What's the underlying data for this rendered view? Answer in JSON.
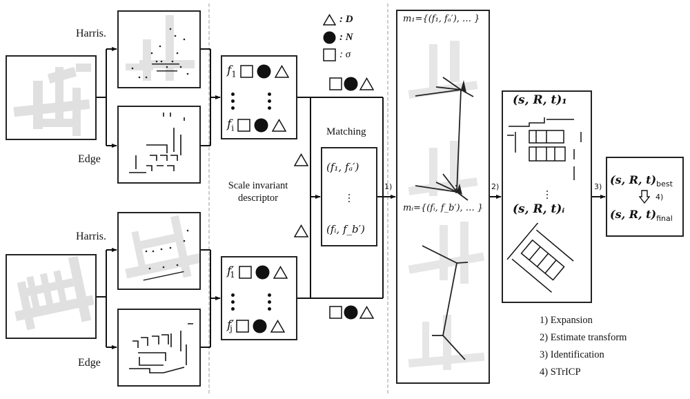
{
  "figure": {
    "branch_labels": {
      "top_harris": "Harris.",
      "top_edge": "Edge",
      "bottom_harris": "Harris.",
      "bottom_edge": "Edge"
    },
    "legend": {
      "items": [
        {
          "symbol": "triangle",
          "label": ": D"
        },
        {
          "symbol": "filled-circle",
          "label": ": N"
        },
        {
          "symbol": "square",
          "label": ": σ"
        }
      ]
    },
    "descriptor": {
      "caption_line1": "Scale invariant",
      "caption_line2": "descriptor",
      "top_rows": [
        {
          "feature": "f",
          "sub": "1",
          "prime": ""
        },
        {
          "feature": "f",
          "sub": "i",
          "prime": ""
        }
      ],
      "bottom_rows": [
        {
          "feature": "f",
          "sub": "1",
          "prime": "′"
        },
        {
          "feature": "f",
          "sub": "j",
          "prime": "′"
        }
      ]
    },
    "matching": {
      "title": "Matching",
      "pair_first": "(f₁, fₐ′)",
      "pair_last": "(fᵢ, f_b′)",
      "ellipsis": "⋮"
    },
    "expansion": {
      "m1_label": "m₁={(f₁, fₐ′), … }",
      "mi_label": "mᵢ={(fᵢ, f_b′), … }"
    },
    "transforms": {
      "first_label": "(s, R, t)₁",
      "ith_label": "(s, R, t)ᵢ"
    },
    "final": {
      "best_label": "(s, R, t)",
      "best_sub": "best",
      "final_label": "(s, R, t)",
      "final_sub": "final",
      "step_tag": "4)"
    },
    "arrow_tags": {
      "step1": "1)",
      "step2": "2)",
      "step3": "3)"
    },
    "steps_legend": [
      "1) Expansion",
      "2) Estimate transform",
      "3) Identification",
      "4) STrICP"
    ]
  }
}
